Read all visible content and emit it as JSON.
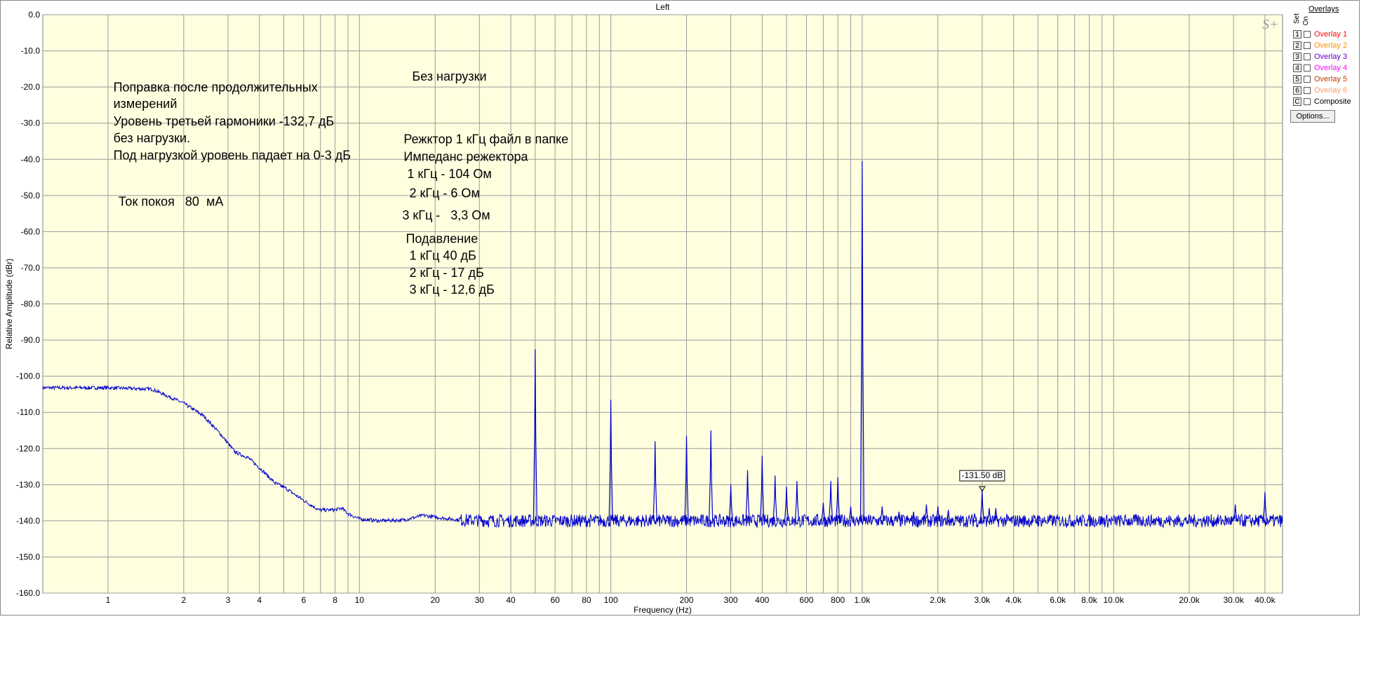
{
  "chart_data": {
    "type": "line",
    "title": "Left",
    "xlabel": "Frequency (Hz)",
    "ylabel": "Relative Amplitude (dBr)",
    "xscale": "log",
    "xlim": [
      0.55,
      47000
    ],
    "ylim": [
      -160,
      0
    ],
    "grid": true,
    "background_color": "#ffffe0",
    "line_color": "#0000cc",
    "y_ticks": [
      0,
      -10,
      -20,
      -30,
      -40,
      -50,
      -60,
      -70,
      -80,
      -90,
      -100,
      -110,
      -120,
      -130,
      -140,
      -150,
      -160
    ],
    "y_tick_labels": [
      "0.0",
      "-10.0",
      "-20.0",
      "-30.0",
      "-40.0",
      "-50.0",
      "-60.0",
      "-70.0",
      "-80.0",
      "-90.0",
      "-100.0",
      "-110.0",
      "-120.0",
      "-130.0",
      "-140.0",
      "-150.0",
      "-160.0"
    ],
    "x_ticks": [
      1,
      2,
      3,
      4,
      6,
      8,
      10,
      20,
      30,
      40,
      60,
      80,
      100,
      200,
      300,
      400,
      600,
      800,
      1000,
      2000,
      3000,
      4000,
      6000,
      8000,
      10000,
      20000,
      30000,
      40000
    ],
    "x_tick_labels": [
      "1",
      "2",
      "3",
      "4",
      "6",
      "8",
      "10",
      "20",
      "30",
      "40",
      "60",
      "80",
      "100",
      "200",
      "300",
      "400",
      "600",
      "800",
      "1.0k",
      "2.0k",
      "3.0k",
      "4.0k",
      "6.0k",
      "8.0k",
      "10.0k",
      "20.0k",
      "30.0k",
      "40.0k"
    ],
    "series": [
      {
        "baseline": [
          [
            0.55,
            -103.2
          ],
          [
            1,
            -103.2
          ],
          [
            1.5,
            -103.6
          ],
          [
            2,
            -107.5
          ],
          [
            2.4,
            -111
          ],
          [
            2.8,
            -116
          ],
          [
            3.2,
            -121
          ],
          [
            3.6,
            -122.5
          ],
          [
            4.1,
            -126
          ],
          [
            4.6,
            -129.5
          ],
          [
            5.1,
            -131
          ],
          [
            5.6,
            -133
          ],
          [
            6.2,
            -135
          ],
          [
            6.9,
            -137
          ],
          [
            8,
            -137
          ],
          [
            8.5,
            -136.5
          ],
          [
            9,
            -138
          ],
          [
            10,
            -139.5
          ],
          [
            12,
            -140
          ],
          [
            15,
            -139.8
          ],
          [
            18,
            -138.5
          ],
          [
            20,
            -139
          ],
          [
            25,
            -139.8
          ],
          [
            40,
            -140
          ],
          [
            47000,
            -140
          ]
        ],
        "peaks": [
          [
            50,
            -92.5
          ],
          [
            100,
            -106.5
          ],
          [
            150,
            -118
          ],
          [
            200,
            -116.5
          ],
          [
            250,
            -115
          ],
          [
            300,
            -130
          ],
          [
            350,
            -126
          ],
          [
            400,
            -122
          ],
          [
            450,
            -127.5
          ],
          [
            500,
            -130.5
          ],
          [
            550,
            -129
          ],
          [
            700,
            -135
          ],
          [
            750,
            -129
          ],
          [
            800,
            -128
          ],
          [
            900,
            -136
          ],
          [
            1000,
            -40.5
          ],
          [
            1200,
            -136
          ],
          [
            1400,
            -137.5
          ],
          [
            1600,
            -137.5
          ],
          [
            1800,
            -135.5
          ],
          [
            2000,
            -136
          ],
          [
            2200,
            -137
          ],
          [
            2800,
            -138
          ],
          [
            3000,
            -131.5
          ],
          [
            3200,
            -136.5
          ],
          [
            3400,
            -136.5
          ],
          [
            5000,
            -138.5
          ],
          [
            30500,
            -135.5
          ],
          [
            40000,
            -132
          ]
        ]
      }
    ],
    "marker": {
      "x": 3000,
      "y": -131.5,
      "label": "-131.50 dB"
    },
    "annotations": [
      {
        "text": "Поправка после продолжительных",
        "x": 1.05,
        "y": -21.2
      },
      {
        "text": "измерений",
        "x": 1.05,
        "y": -25.8
      },
      {
        "text": "Уровень третьей гармоники -132,7 дБ",
        "x": 1.05,
        "y": -30.6
      },
      {
        "text": "без нагрузки.",
        "x": 1.05,
        "y": -35.3
      },
      {
        "text": "Под нагрузкой уровень падает на 0-3 дБ",
        "x": 1.05,
        "y": -40.0
      },
      {
        "text": "Ток покоя   80  мА",
        "x": 1.1,
        "y": -52.8
      },
      {
        "text": "Без нагрузки",
        "x": 16.2,
        "y": -18.2
      },
      {
        "text": "Режктор 1 кГц файл в папке",
        "x": 15.0,
        "y": -35.6
      },
      {
        "text": "Импеданс режектора",
        "x": 15.0,
        "y": -40.4
      },
      {
        "text": " 1 кГц - 104 Ом",
        "x": 15.0,
        "y": -45.2
      },
      {
        "text": " 2 кГц - 6 Ом",
        "x": 15.3,
        "y": -50.5
      },
      {
        "text": "3 кГц -   3,3 Ом",
        "x": 14.8,
        "y": -56.6
      },
      {
        "text": "Подавление",
        "x": 15.3,
        "y": -63.1
      },
      {
        "text": " 1 кГц 40 дБ",
        "x": 15.3,
        "y": -67.8
      },
      {
        "text": " 2 кГц - 17 дБ",
        "x": 15.3,
        "y": -72.5
      },
      {
        "text": " 3 кГц - 12,6 дБ",
        "x": 15.3,
        "y": -77.2
      }
    ]
  },
  "panel": {
    "logo": "S+",
    "overlays_title": "Overlays",
    "set_label": "Set",
    "on_label": "On",
    "options_label": "Options...",
    "items": [
      {
        "key": "1",
        "label": "Overlay 1",
        "color": "#ff0000"
      },
      {
        "key": "2",
        "label": "Overlay 2",
        "color": "#ff8c00"
      },
      {
        "key": "3",
        "label": "Overlay 3",
        "color": "#6600cc"
      },
      {
        "key": "4",
        "label": "Overlay 4",
        "color": "#ff00ff"
      },
      {
        "key": "5",
        "label": "Overlay 5",
        "color": "#cc3300"
      },
      {
        "key": "6",
        "label": "Overlay 6",
        "color": "#ff9966"
      },
      {
        "key": "C",
        "label": "Composite",
        "color": "#000000"
      }
    ]
  }
}
